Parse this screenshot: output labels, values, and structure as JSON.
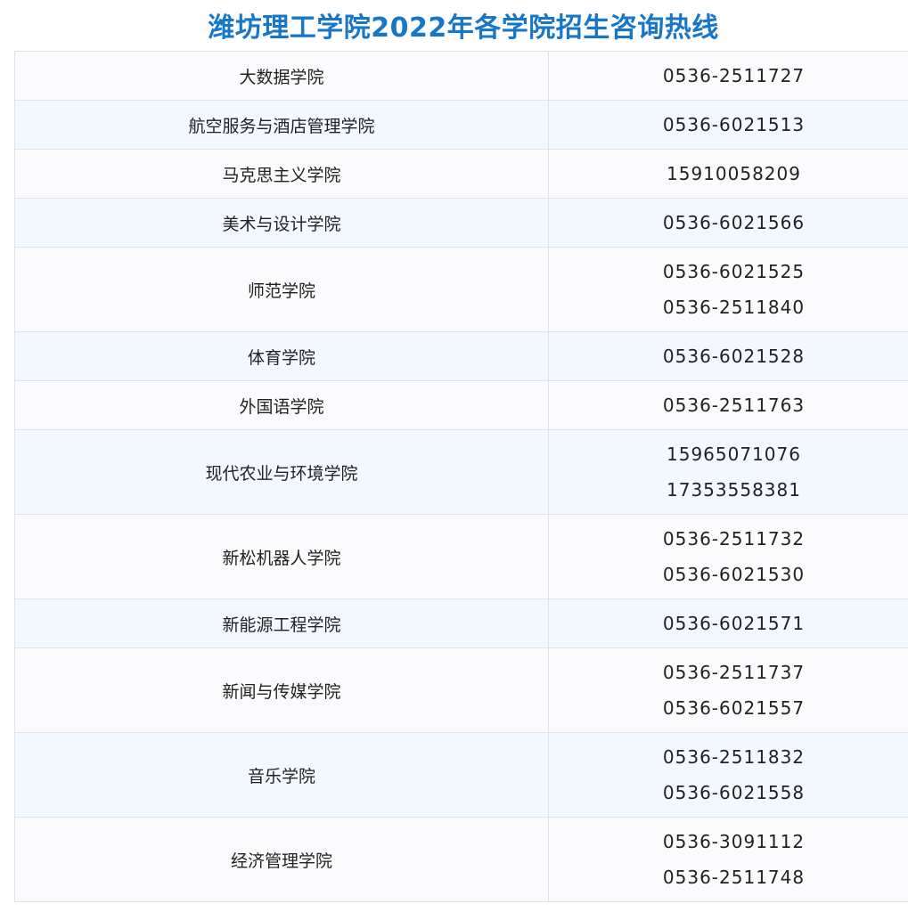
{
  "title": "潍坊理工学院2022年各学院招生咨询热线",
  "rows": [
    {
      "college": "大数据学院",
      "phones": [
        "0536-2511727"
      ]
    },
    {
      "college": "航空服务与酒店管理学院",
      "phones": [
        "0536-6021513"
      ]
    },
    {
      "college": "马克思主义学院",
      "phones": [
        "15910058209"
      ]
    },
    {
      "college": "美术与设计学院",
      "phones": [
        "0536-6021566"
      ]
    },
    {
      "college": "师范学院",
      "phones": [
        "0536-6021525",
        "0536-2511840"
      ]
    },
    {
      "college": "体育学院",
      "phones": [
        "0536-6021528"
      ]
    },
    {
      "college": "外国语学院",
      "phones": [
        "0536-2511763"
      ]
    },
    {
      "college": "现代农业与环境学院",
      "phones": [
        "15965071076",
        "17353558381"
      ]
    },
    {
      "college": "新松机器人学院",
      "phones": [
        "0536-2511732",
        "0536-6021530"
      ]
    },
    {
      "college": "新能源工程学院",
      "phones": [
        "0536-6021571"
      ]
    },
    {
      "college": "新闻与传媒学院",
      "phones": [
        "0536-2511737",
        "0536-6021557"
      ]
    },
    {
      "college": "音乐学院",
      "phones": [
        "0536-2511832",
        "0536-6021558"
      ]
    },
    {
      "college": "经济管理学院",
      "phones": [
        "0536-3091112",
        "0536-2511748"
      ]
    }
  ],
  "colors": {
    "title": "#1677c8",
    "row_odd": "#fbfbfd",
    "row_even": "#f3f8fe",
    "border": "#dde2e8"
  }
}
